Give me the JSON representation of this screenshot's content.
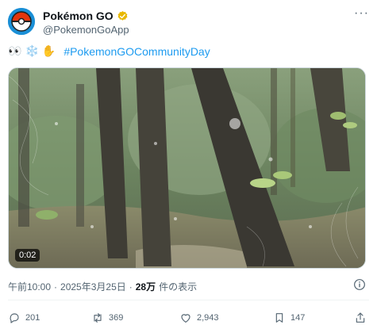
{
  "account": {
    "display_name": "Pokémon GO",
    "handle": "@PokemonGoApp",
    "avatar_icon": "pokeball-icon",
    "verified_color": "#e8b800"
  },
  "tweet": {
    "emojis": [
      "👀",
      "❄️",
      "✋"
    ],
    "hashtag": "#PokemonGOCommunityDay"
  },
  "media": {
    "duration": "0:02"
  },
  "meta": {
    "time": "午前10:00",
    "separator1": "·",
    "date": "2025年3月25日",
    "separator2": "·",
    "views_count": "28万",
    "views_label": "件の表示"
  },
  "actions": {
    "replies": "201",
    "retweets": "369",
    "likes": "2,943",
    "bookmarks": "147"
  },
  "colors": {
    "accent": "#1d9bf0",
    "muted": "#536471"
  }
}
